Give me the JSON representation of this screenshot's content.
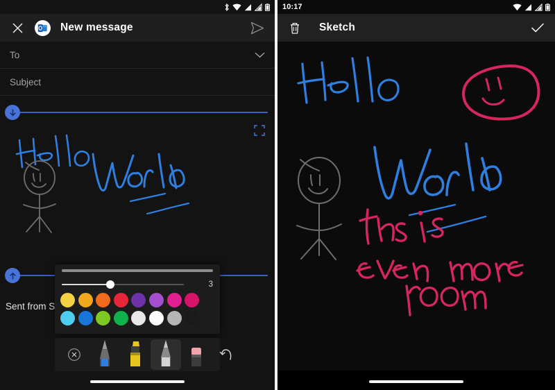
{
  "left_panel": {
    "statusbar": {
      "time": "",
      "icons": [
        "bluetooth-icon",
        "wifi-icon",
        "signal-icon",
        "signal-alt-icon",
        "battery-icon"
      ]
    },
    "appbar": {
      "close_label": "close-icon",
      "app_badge": "outlook-logo",
      "title": "New message",
      "send_label": "send-icon"
    },
    "fields": [
      {
        "name": "to",
        "placeholder": "To",
        "value": "",
        "chevron": "chevron-down-icon"
      },
      {
        "name": "subject",
        "placeholder": "Subject",
        "value": ""
      }
    ],
    "ink_region": {
      "expand_icon": "expand-icon",
      "top_handle": "arrow-down-icon",
      "bottom_handle": "arrow-up-icon"
    },
    "signature": "Sent from Su",
    "tool_popup": {
      "thickness_value": "3",
      "thickness_percent": 36,
      "colors_row1": [
        "#f5d042",
        "#f2a81d",
        "#f26a1b",
        "#e8263a",
        "#6d32a8",
        "#a44fd0",
        "#e02090",
        "#d8146a"
      ],
      "colors_row2": [
        "#4ecdf0",
        "#1776d8",
        "#7fc722",
        "#11b24e",
        "#e8e8e8",
        "#fbfbfb",
        "#b5b5b5",
        "#1a1a1a"
      ]
    },
    "tools": [
      {
        "name": "close-tools",
        "icon": "close-circle-icon",
        "selected": false
      },
      {
        "name": "pen",
        "icon": "pen-icon",
        "color": "#2f7fe0",
        "selected": false
      },
      {
        "name": "highlighter",
        "icon": "highlighter-icon",
        "color": "#e8c51e",
        "selected": false
      },
      {
        "name": "pencil",
        "icon": "pencil-icon",
        "color": "#cfcfcf",
        "selected": true
      },
      {
        "name": "eraser",
        "icon": "eraser-icon",
        "color": "#f0a3a8",
        "selected": false
      },
      {
        "name": "undo",
        "icon": "undo-icon",
        "selected": false
      }
    ]
  },
  "right_panel": {
    "statusbar": {
      "time": "10:17",
      "icons": [
        "wifi-icon",
        "signal-icon",
        "signal-alt-icon",
        "battery-icon"
      ]
    },
    "appbar": {
      "delete_label": "trash-icon",
      "title": "Sketch",
      "confirm_label": "check-icon"
    },
    "tools": [
      {
        "name": "pen",
        "icon": "pen-icon",
        "color": "#e0205f",
        "selected": true
      },
      {
        "name": "highlighter",
        "icon": "highlighter-icon",
        "color": "#e8c51e",
        "selected": false
      },
      {
        "name": "pencil",
        "icon": "pencil-icon",
        "color": "#cfcfcf",
        "selected": false
      },
      {
        "name": "eraser",
        "icon": "eraser-icon",
        "color": "#f0a3a8",
        "selected": false
      },
      {
        "name": "undo",
        "icon": "undo-icon",
        "selected": false
      }
    ]
  },
  "drawing": {
    "hello_text": "Hello",
    "world_text": "World",
    "pink_text": "this is even more room",
    "ink_blue": "#2f7fe0",
    "ink_gray": "#6e6e6e",
    "ink_pink": "#d6265e"
  }
}
